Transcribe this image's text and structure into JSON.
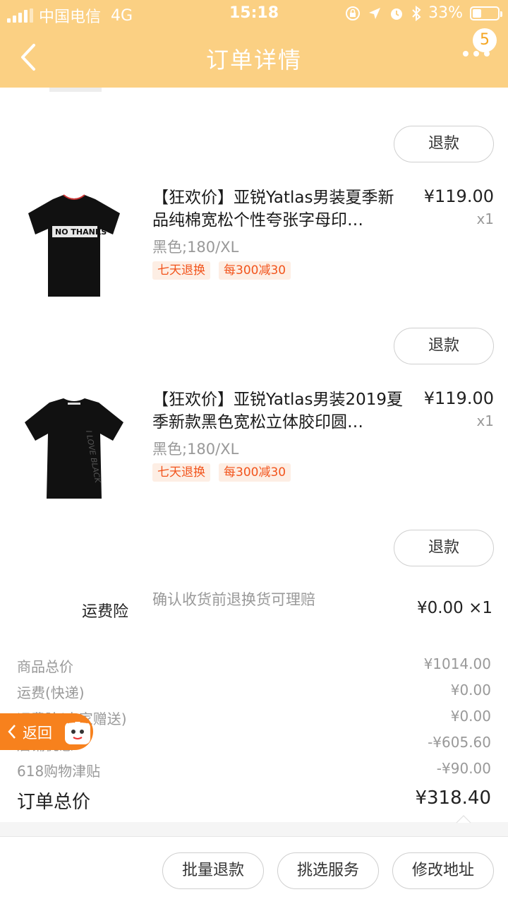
{
  "status_bar": {
    "carrier": "中国电信",
    "network": "4G",
    "time": "15:18",
    "battery": "33%"
  },
  "nav": {
    "title": "订单详情",
    "badge": "5"
  },
  "products": [
    {
      "title": "【狂欢价】亚锐Yatlas男装夏季新品纯棉宽松个性夸张字母印…",
      "sku": "黑色;180/XL",
      "tags": [
        "七天退换",
        "每300减30"
      ],
      "price": "¥119.00",
      "qty": "x1",
      "shirt_text": "NO THANKS"
    },
    {
      "title": "【狂欢价】亚锐Yatlas男装2019夏季新款黑色宽松立体胶印圆…",
      "sku": "黑色;180/XL",
      "tags": [
        "七天退换",
        "每300减30"
      ],
      "price": "¥119.00",
      "qty": "x1",
      "shirt_text": "I LOVE BLACK"
    }
  ],
  "refund_label": "退款",
  "insurance": {
    "label": "运费险",
    "desc": "确认收货前退换货可理赔",
    "price": "¥0.00 ×1"
  },
  "summary": [
    {
      "label": "商品总价",
      "value": "¥1014.00"
    },
    {
      "label": "运费(快递)",
      "value": "¥0.00"
    },
    {
      "label": "运费险(卖家赠送)",
      "value": "¥0.00"
    },
    {
      "label": "店铺优惠",
      "value": "-¥605.60"
    },
    {
      "label": "618购物津贴",
      "value": "-¥90.00"
    }
  ],
  "total": {
    "label": "订单总价",
    "value": "¥318.40"
  },
  "float_return": "返回",
  "bottom_buttons": [
    "批量退款",
    "挑选服务",
    "修改地址"
  ],
  "colors": {
    "header": "#fbd083",
    "accent": "#f7811d",
    "tag_text": "#f2541c",
    "tag_bg": "#fdeee4"
  }
}
